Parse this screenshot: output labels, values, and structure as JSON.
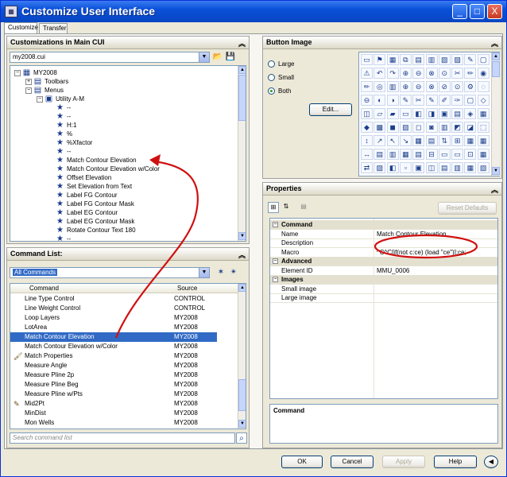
{
  "window": {
    "title": "Customize User Interface",
    "min": "_",
    "max": "□",
    "close": "X"
  },
  "tabs": [
    "Customize",
    "Transfer"
  ],
  "cui_panel": {
    "header": "Customizations in Main CUI",
    "file": "my2008.cui",
    "tree": [
      {
        "label": "MY2008",
        "expander": "−",
        "icon": "▦",
        "indent": 0
      },
      {
        "label": "Toolbars",
        "expander": "+",
        "icon": "▤",
        "indent": 1
      },
      {
        "label": "Menus",
        "expander": "−",
        "icon": "▤",
        "indent": 1
      },
      {
        "label": "Utility A-M",
        "expander": "−",
        "icon": "▣",
        "indent": 2
      },
      {
        "label": "--",
        "icon": "★",
        "indent": 3
      },
      {
        "label": "--",
        "icon": "★",
        "indent": 3
      },
      {
        "label": "H:1",
        "icon": "★",
        "indent": 3
      },
      {
        "label": "%",
        "icon": "★",
        "indent": 3
      },
      {
        "label": "%Xfactor",
        "icon": "★",
        "indent": 3
      },
      {
        "label": "--",
        "icon": "★",
        "indent": 3
      },
      {
        "label": "Match Contour Elevation",
        "icon": "★",
        "indent": 3
      },
      {
        "label": "Match Contour Elevation w/Color",
        "icon": "★",
        "indent": 3
      },
      {
        "label": "Offset Elevation",
        "icon": "★",
        "indent": 3
      },
      {
        "label": "Set Elevation from Text",
        "icon": "★",
        "indent": 3
      },
      {
        "label": "Label FG Contour",
        "icon": "★",
        "indent": 3
      },
      {
        "label": "Label FG Contour Mask",
        "icon": "★",
        "indent": 3
      },
      {
        "label": "Label EG Contour",
        "icon": "★",
        "indent": 3
      },
      {
        "label": "Label EG Contour Mask",
        "icon": "★",
        "indent": 3
      },
      {
        "label": "Rotate Contour Text 180",
        "icon": "★",
        "indent": 3
      },
      {
        "label": "--",
        "icon": "★",
        "indent": 3
      }
    ]
  },
  "command_panel": {
    "header": "Command List:",
    "filter": "All Commands",
    "columns": [
      "Command",
      "Source"
    ],
    "rows": [
      {
        "command": "Line Type Control",
        "source": "CONTROL"
      },
      {
        "command": "Line Weight Control",
        "source": "CONTROL"
      },
      {
        "command": "Loop Layers",
        "source": "MY2008"
      },
      {
        "command": "LotArea",
        "source": "MY2008"
      },
      {
        "command": "Match Contour Elevation",
        "source": "MY2008",
        "selected": true
      },
      {
        "command": "Match Contour Elevation w/Color",
        "source": "MY2008"
      },
      {
        "command": "Match Properties",
        "source": "MY2008",
        "icon": "🖌"
      },
      {
        "command": "Measure Angle",
        "source": "MY2008"
      },
      {
        "command": "Measure Pline 2p",
        "source": "MY2008"
      },
      {
        "command": "Measure Pline Beg",
        "source": "MY2008"
      },
      {
        "command": "Measure Pline w/Pts",
        "source": "MY2008"
      },
      {
        "command": "Mid2Pt",
        "source": "MY2008",
        "icon": "✎"
      },
      {
        "command": "MinDist",
        "source": "MY2008"
      },
      {
        "command": "Mon Wells",
        "source": "MY2008"
      }
    ],
    "search_placeholder": "Search command list"
  },
  "button_image": {
    "header": "Button Image",
    "options": [
      "Large",
      "Small",
      "Both"
    ],
    "selected": "Both",
    "edit_label": "Edit...",
    "icons": [
      "▭",
      "⚑",
      "▦",
      "⧉",
      "▤",
      "▥",
      "▧",
      "▨",
      "✎",
      "▢",
      "⚠",
      "↶",
      "↷",
      "⊕",
      "⊖",
      "⊗",
      "⊙",
      "✂",
      "✏",
      "◉",
      "✏",
      "◎",
      "▥",
      "⊕",
      "⊖",
      "⊗",
      "⊘",
      "⊙",
      "⚙",
      "◌",
      "⊖",
      "◐",
      "◑",
      "✎",
      "✂",
      "✎",
      "✐",
      "✑",
      "▢",
      "◇",
      "◫",
      "▱",
      "▰",
      "▭",
      "◧",
      "◨",
      "▣",
      "▤",
      "◈",
      "▦",
      "◆",
      "▩",
      "◼",
      "▨",
      "◻",
      "◙",
      "▥",
      "◩",
      "◪",
      "⬚",
      "↕",
      "↗",
      "↖",
      "↘",
      "▦",
      "▤",
      "⇅",
      "⊞",
      "▦",
      "▦",
      "↔",
      "▤",
      "▥",
      "▦",
      "▤",
      "⊟",
      "▭",
      "▭",
      "⊡",
      "▦",
      "⇄",
      "▨",
      "◧",
      "▫",
      "▣",
      "◫",
      "▤",
      "▥",
      "▦",
      "▧"
    ]
  },
  "properties": {
    "header": "Properties",
    "reset_label": "Reset Defaults",
    "rows": [
      {
        "type": "cat",
        "key": "Command"
      },
      {
        "type": "row",
        "key": "Name",
        "value": "Match Contour Elevation"
      },
      {
        "type": "row",
        "key": "Description",
        "value": ""
      },
      {
        "type": "row",
        "key": "Macro",
        "value": "^C^C[if(not c:ce) (load \"ce\")];ce;"
      },
      {
        "type": "cat",
        "key": "Advanced"
      },
      {
        "type": "row",
        "key": "Element ID",
        "value": "MMU_0006"
      },
      {
        "type": "cat",
        "key": "Images"
      },
      {
        "type": "row",
        "key": "Small image",
        "value": ""
      },
      {
        "type": "row",
        "key": "Large image",
        "value": ""
      }
    ],
    "desc_title": "Command"
  },
  "footer": {
    "ok": "OK",
    "cancel": "Cancel",
    "apply": "Apply",
    "help": "Help",
    "more": "◀"
  },
  "colors": {
    "titlebar": "#0a50d8",
    "selection": "#316ac5",
    "annotation": "#d01010"
  }
}
